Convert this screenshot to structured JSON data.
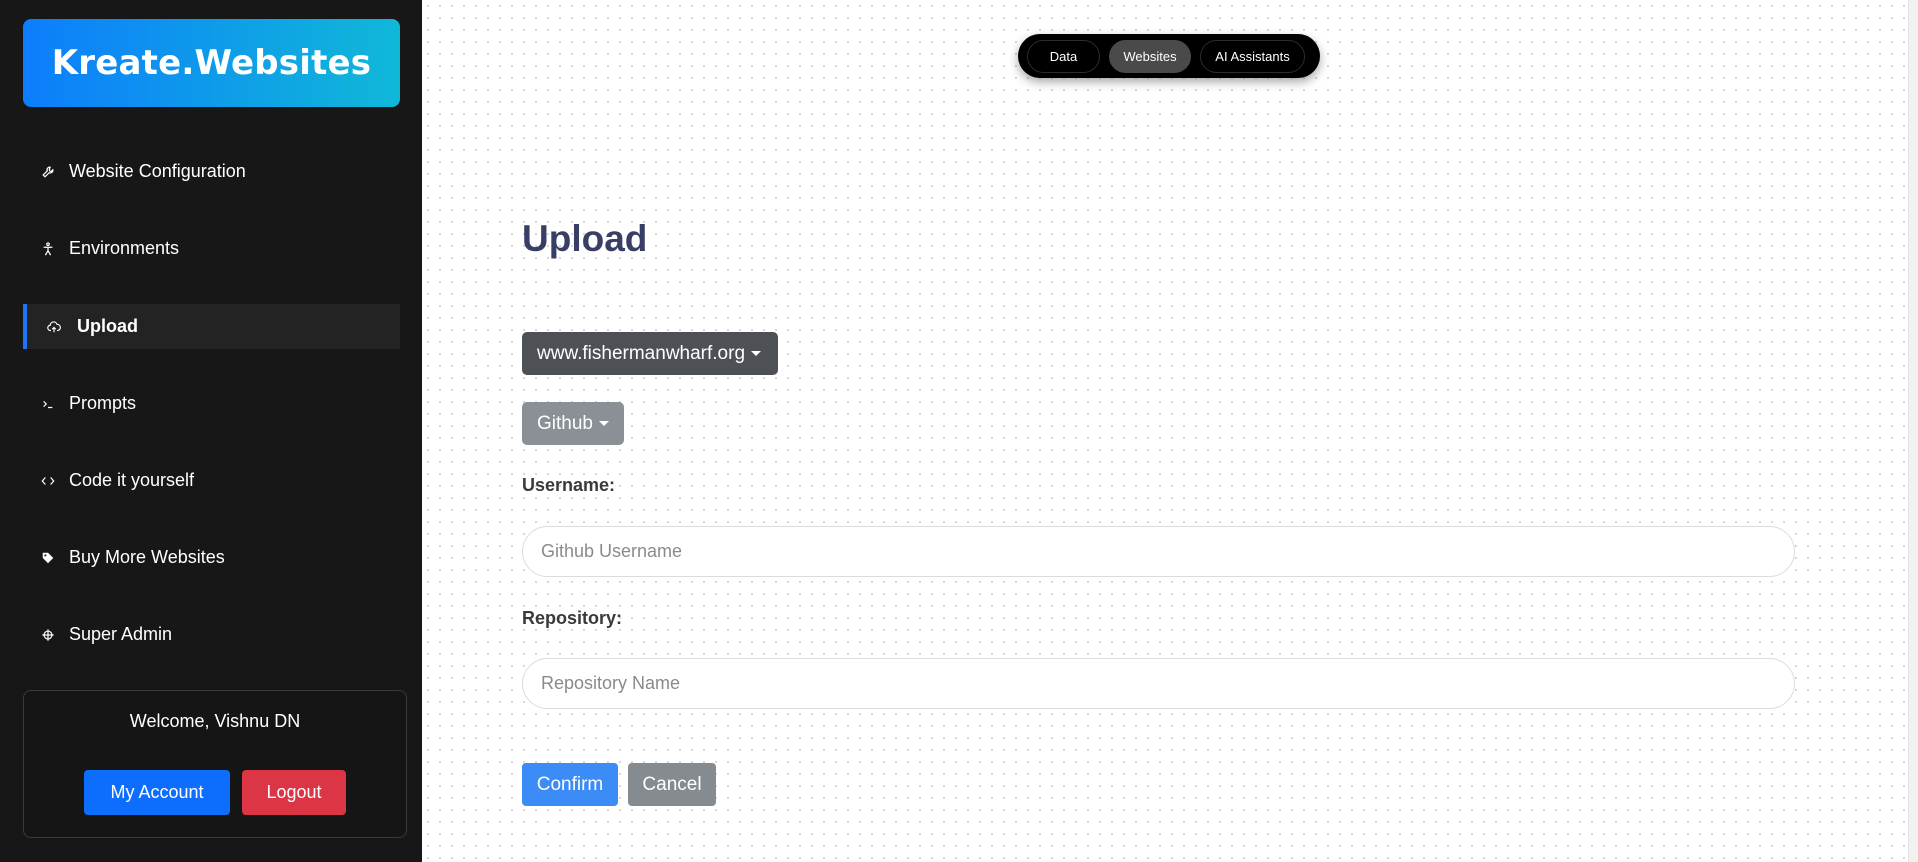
{
  "sidebar": {
    "logo": "Kreate.Websites",
    "items": [
      {
        "label": "Website Configuration",
        "icon": "wrench-icon"
      },
      {
        "label": "Environments",
        "icon": "person-icon"
      },
      {
        "label": "Upload",
        "icon": "cloud-upload-icon",
        "active": true
      },
      {
        "label": "Prompts",
        "icon": "terminal-icon"
      },
      {
        "label": "Code it yourself",
        "icon": "code-icon"
      },
      {
        "label": "Buy More Websites",
        "icon": "tag-icon"
      },
      {
        "label": "Super Admin",
        "icon": "admin-icon"
      }
    ],
    "account": {
      "welcome": "Welcome, Vishnu DN",
      "my_account": "My Account",
      "logout": "Logout"
    }
  },
  "topnav": {
    "items": [
      "Data",
      "Websites",
      "AI Assistants"
    ],
    "active": "Websites"
  },
  "main": {
    "title": "Upload",
    "site_dropdown": "www.fishermanwharf.org",
    "provider_dropdown": "Github",
    "username_label": "Username:",
    "username_placeholder": "Github Username",
    "repository_label": "Repository:",
    "repository_placeholder": "Repository Name",
    "confirm": "Confirm",
    "cancel": "Cancel"
  },
  "colors": {
    "sidebar_bg": "#171717",
    "accent": "#0d6efd",
    "danger": "#dc3545",
    "title": "#383e66"
  }
}
